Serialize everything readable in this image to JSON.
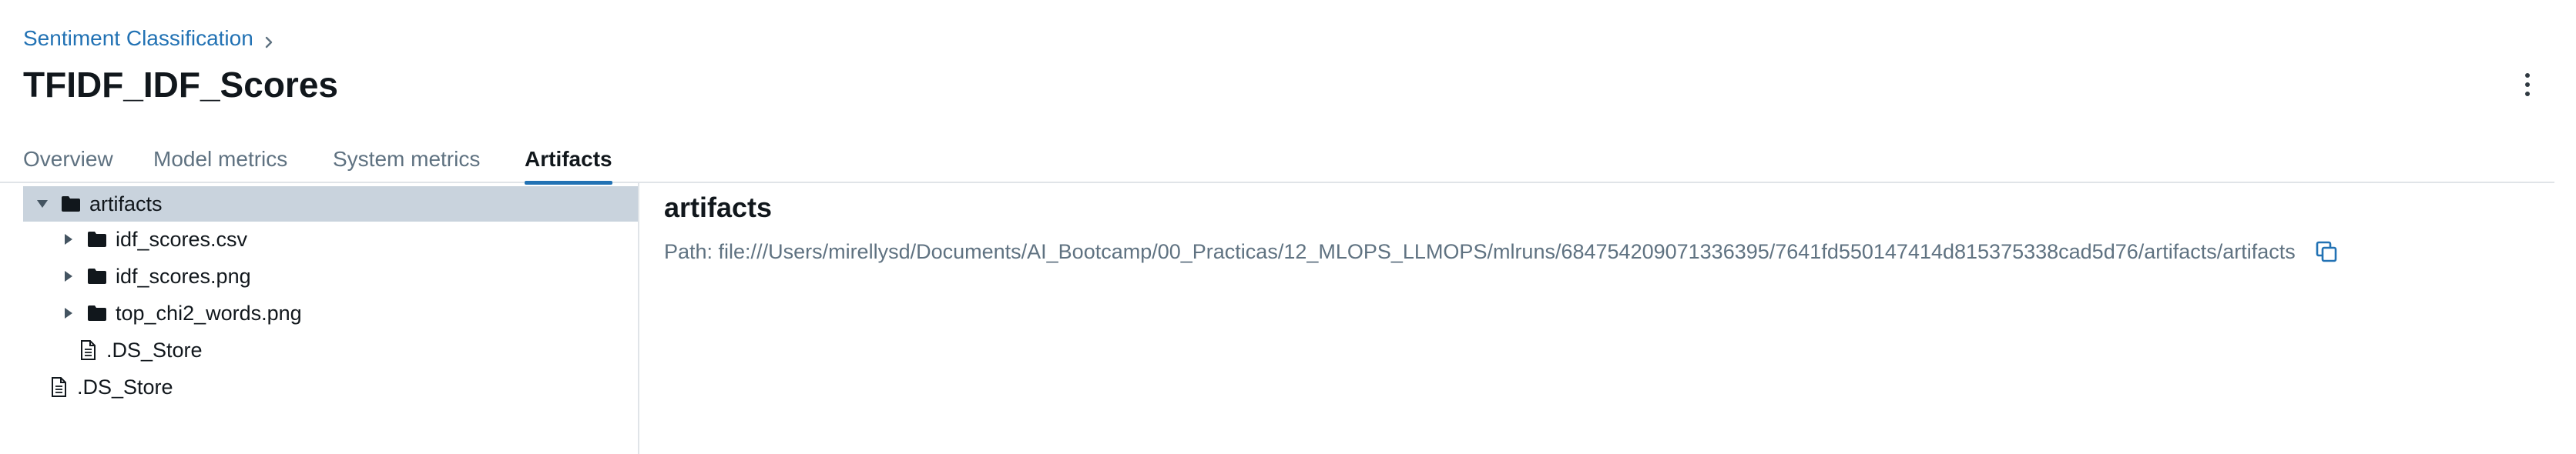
{
  "breadcrumb": {
    "experiment": "Sentiment Classification"
  },
  "title": "TFIDF_IDF_Scores",
  "tabs": [
    {
      "label": "Overview"
    },
    {
      "label": "Model metrics"
    },
    {
      "label": "System metrics"
    },
    {
      "label": "Artifacts",
      "active": true
    }
  ],
  "tree": {
    "root": {
      "label": "artifacts",
      "expanded": true,
      "selected": true
    },
    "children": [
      {
        "label": "idf_scores.csv",
        "type": "folder"
      },
      {
        "label": "idf_scores.png",
        "type": "folder"
      },
      {
        "label": "top_chi2_words.png",
        "type": "folder"
      },
      {
        "label": ".DS_Store",
        "type": "file"
      }
    ],
    "sibling": {
      "label": ".DS_Store",
      "type": "file"
    }
  },
  "details": {
    "title": "artifacts",
    "path": "Path: file:///Users/mirellysd/Documents/AI_Bootcamp/00_Practicas/12_MLOPS_LLMOPS/mlruns/684754209071336395/7641fd550147414d815375338cad5d76/artifacts/artifacts"
  },
  "colors": {
    "link": "#2272b4",
    "active_tab_underline": "#2272b4",
    "selected_row": "#c9d3dd",
    "muted_text": "#5f7281"
  }
}
